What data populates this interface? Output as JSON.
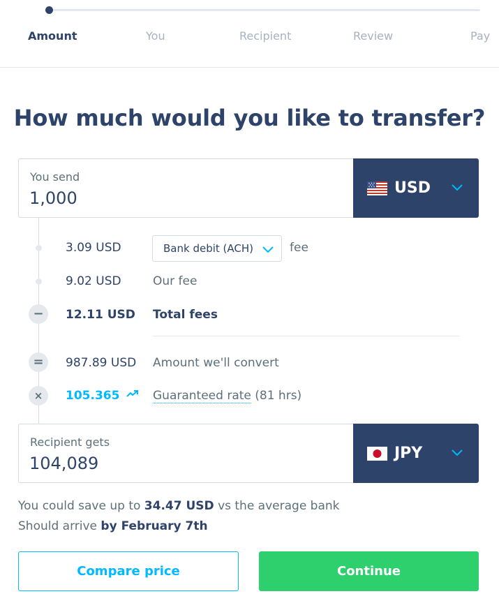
{
  "stepper": {
    "steps": [
      "Amount",
      "You",
      "Recipient",
      "Review",
      "Pay"
    ],
    "active_index": 0,
    "progress": 0.0
  },
  "heading": "How much would you like to transfer?",
  "send": {
    "label": "You send",
    "value": "1,000",
    "currency": "USD",
    "flag_icon": "us-flag-icon"
  },
  "breakdown": {
    "payment_fee": {
      "amount": "3.09 USD",
      "method": "Bank debit (ACH)",
      "suffix": "fee"
    },
    "our_fee": {
      "amount": "9.02 USD",
      "label": "Our fee"
    },
    "total_fees": {
      "amount": "12.11 USD",
      "label": "Total fees"
    },
    "convert": {
      "amount": "987.89 USD",
      "label": "Amount we'll convert"
    },
    "rate": {
      "value": "105.365",
      "label": "Guaranteed rate",
      "duration": "(81 hrs)"
    }
  },
  "receive": {
    "label": "Recipient gets",
    "value": "104,089",
    "currency": "JPY",
    "flag_icon": "jp-flag-icon"
  },
  "savings": {
    "prefix": "You could save up to",
    "amount": "34.47 USD",
    "suffix": "vs the average bank"
  },
  "arrival": {
    "prefix": "Should arrive",
    "date": "by February 7th"
  },
  "buttons": {
    "compare": "Compare price",
    "continue": "Continue"
  },
  "colors": {
    "navy": "#2e4369",
    "accent": "#00b9ff",
    "green": "#2ed06e"
  }
}
